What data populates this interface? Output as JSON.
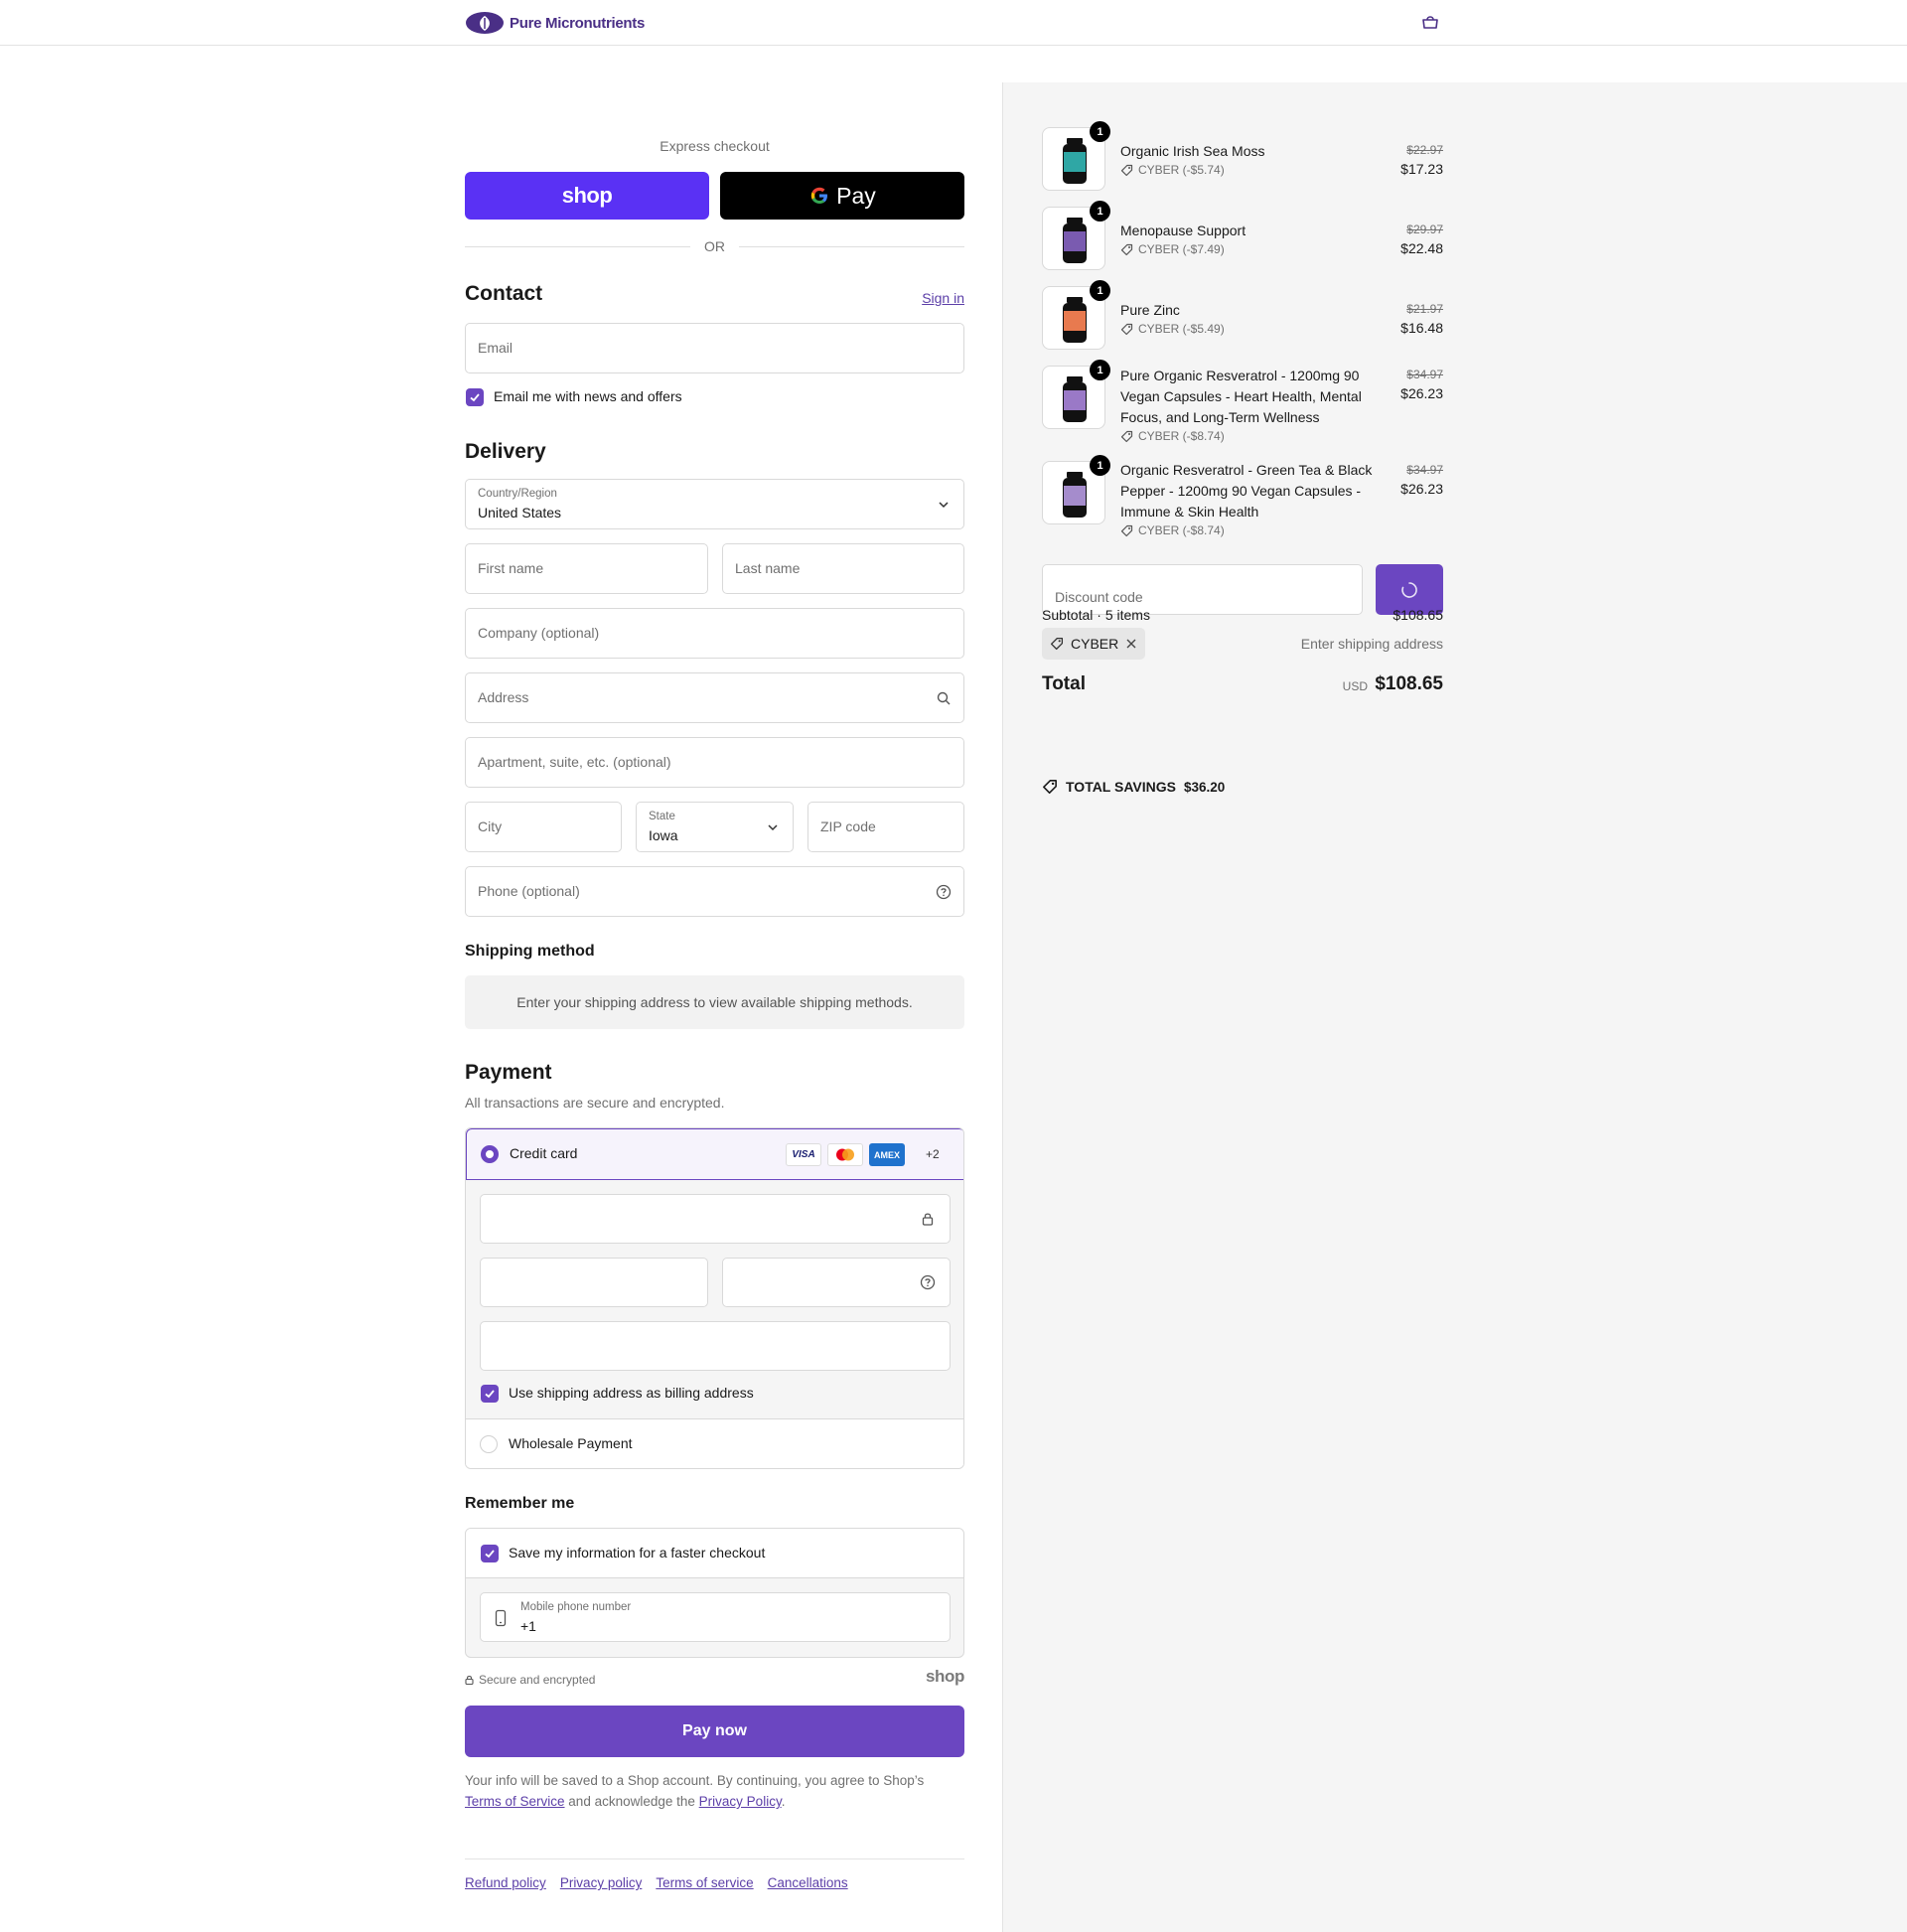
{
  "header": {
    "brand": "Pure Micronutrients"
  },
  "express": {
    "label": "Express checkout",
    "shop_label": "shop",
    "gpay_label": "Pay",
    "or_label": "OR"
  },
  "contact": {
    "title": "Contact",
    "sign_in": "Sign in",
    "email_placeholder": "Email",
    "news_label": "Email me with news and offers"
  },
  "delivery": {
    "title": "Delivery",
    "country_label": "Country/Region",
    "country_value": "United States",
    "first_name": "First name",
    "last_name": "Last name",
    "company": "Company (optional)",
    "address": "Address",
    "apartment": "Apartment, suite, etc. (optional)",
    "city": "City",
    "state_label": "State",
    "state_value": "Iowa",
    "zip": "ZIP code",
    "phone": "Phone (optional)"
  },
  "shipping": {
    "title": "Shipping method",
    "hint": "Enter your shipping address to view available shipping methods."
  },
  "payment": {
    "title": "Payment",
    "subtitle": "All transactions are secure and encrypted.",
    "credit_card": "Credit card",
    "card_brands": [
      "VISA",
      "AMEX"
    ],
    "more_cards": "+2",
    "billing_label": "Use shipping address as billing address",
    "wholesale": "Wholesale Payment"
  },
  "remember": {
    "title": "Remember me",
    "save_label": "Save my information for a faster checkout",
    "mobile_label": "Mobile phone number",
    "mobile_value": "+1",
    "secure": "Secure and encrypted",
    "shop_brand": "shop"
  },
  "pay_now": "Pay now",
  "legal": {
    "text1": "Your info will be saved to a Shop account. By continuing, you agree to Shop’s",
    "tos": "Terms of Service",
    "text2": "and acknowledge the",
    "privacy": "Privacy Policy",
    "period": "."
  },
  "footer": {
    "links": [
      "Refund policy",
      "Privacy policy",
      "Terms of service",
      "Cancellations"
    ]
  },
  "summary": {
    "items": [
      {
        "qty": "1",
        "name": "Organic Irish Sea Moss",
        "discount": "CYBER (-$5.74)",
        "old_price": "$22.97",
        "price": "$17.23",
        "color": "#2fa7a5"
      },
      {
        "qty": "1",
        "name": "Menopause Support",
        "discount": "CYBER (-$7.49)",
        "old_price": "$29.97",
        "price": "$22.48",
        "color": "#7a5bb0"
      },
      {
        "qty": "1",
        "name": "Pure Zinc",
        "discount": "CYBER (-$5.49)",
        "old_price": "$21.97",
        "price": "$16.48",
        "color": "#e87a4f"
      },
      {
        "qty": "1",
        "name": "Pure Organic Resveratrol - 1200mg 90 Vegan Capsules - Heart Health, Mental Focus, and Long-Term Wellness",
        "discount": "CYBER (-$8.74)",
        "old_price": "$34.97",
        "price": "$26.23",
        "color": "#9a79c7"
      },
      {
        "qty": "1",
        "name": "Organic Resveratrol - Green Tea & Black Pepper - 1200mg 90 Vegan Capsules - Immune & Skin Health",
        "discount": "CYBER (-$8.74)",
        "old_price": "$34.97",
        "price": "$26.23",
        "color": "#a58ccc"
      }
    ],
    "discount_placeholder": "Discount code",
    "subtotal_label": "Subtotal · 5 items",
    "subtotal_value": "$108.65",
    "code_tag": "CYBER",
    "shipping_hint": "Enter shipping address",
    "total_label": "Total",
    "currency": "USD",
    "total_value": "$108.65",
    "savings_label": "TOTAL SAVINGS",
    "savings_value": "$36.20"
  },
  "colors": {
    "accent": "#6b46c1",
    "shop_blue": "#5a31f4"
  }
}
